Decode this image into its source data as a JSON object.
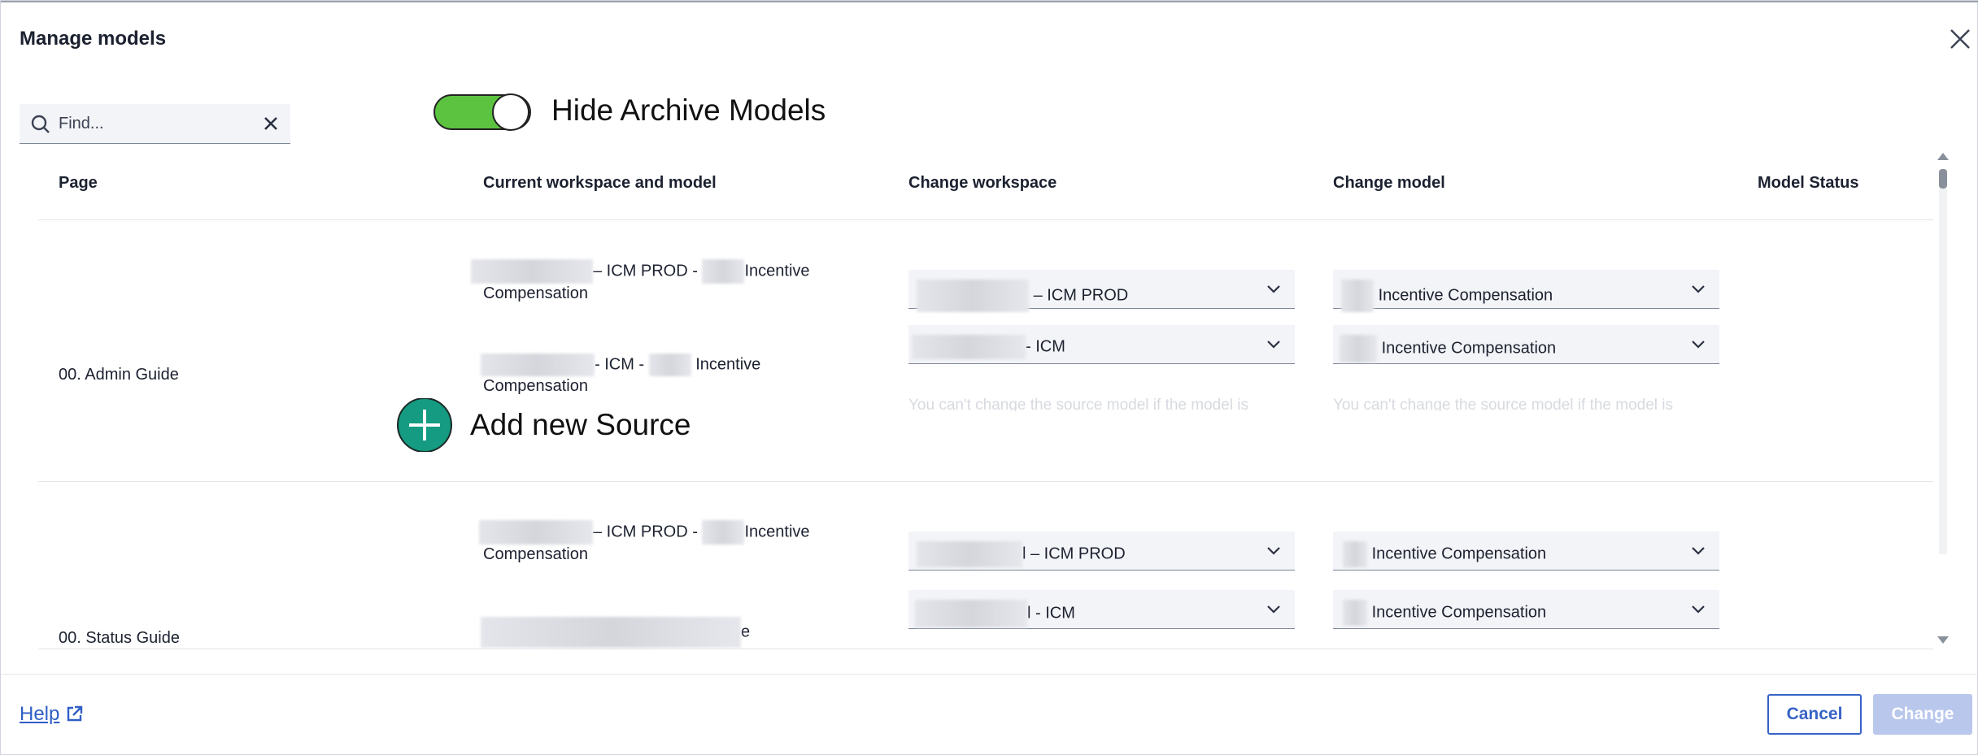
{
  "dialog": {
    "title": "Manage models"
  },
  "search": {
    "placeholder": "Find..."
  },
  "toggle": {
    "label": "Hide Archive Models",
    "on": true,
    "color": "#5cc341"
  },
  "columns": [
    "Page",
    "Current workspace and model",
    "Change workspace",
    "Change model",
    "Model Status"
  ],
  "rows": [
    {
      "page": "00. Admin Guide",
      "current": [
        {
          "mid1": "– ICM PROD -",
          "mid2": "Incentive",
          "line2": "Compensation"
        },
        {
          "mid1": "- ICM -",
          "mid2": "Incentive",
          "line2": "Compensation"
        }
      ],
      "workspace": [
        "– ICM PROD",
        "- ICM"
      ],
      "model": [
        "Incentive Compensation",
        "Incentive Compensation"
      ],
      "note_ws": "You can't change the source model if the model is",
      "note_model": "You can't change the source model if the model is"
    },
    {
      "page": "00. Status Guide",
      "current": [
        {
          "mid1": "– ICM PROD -",
          "mid2": "Incentive",
          "line2": "Compensation"
        },
        {
          "mid1": "",
          "mid2": "e",
          "line2": ""
        }
      ],
      "workspace": [
        "l – ICM PROD",
        "l - ICM"
      ],
      "model": [
        "Incentive Compensation",
        "Incentive Compensation"
      ]
    }
  ],
  "add_source": {
    "label": "Add new Source",
    "color": "#149b82"
  },
  "footer": {
    "help": "Help",
    "cancel": "Cancel",
    "change": "Change"
  },
  "colors": {
    "accent": "#3763c6",
    "disabled": "#b9c7ec"
  }
}
